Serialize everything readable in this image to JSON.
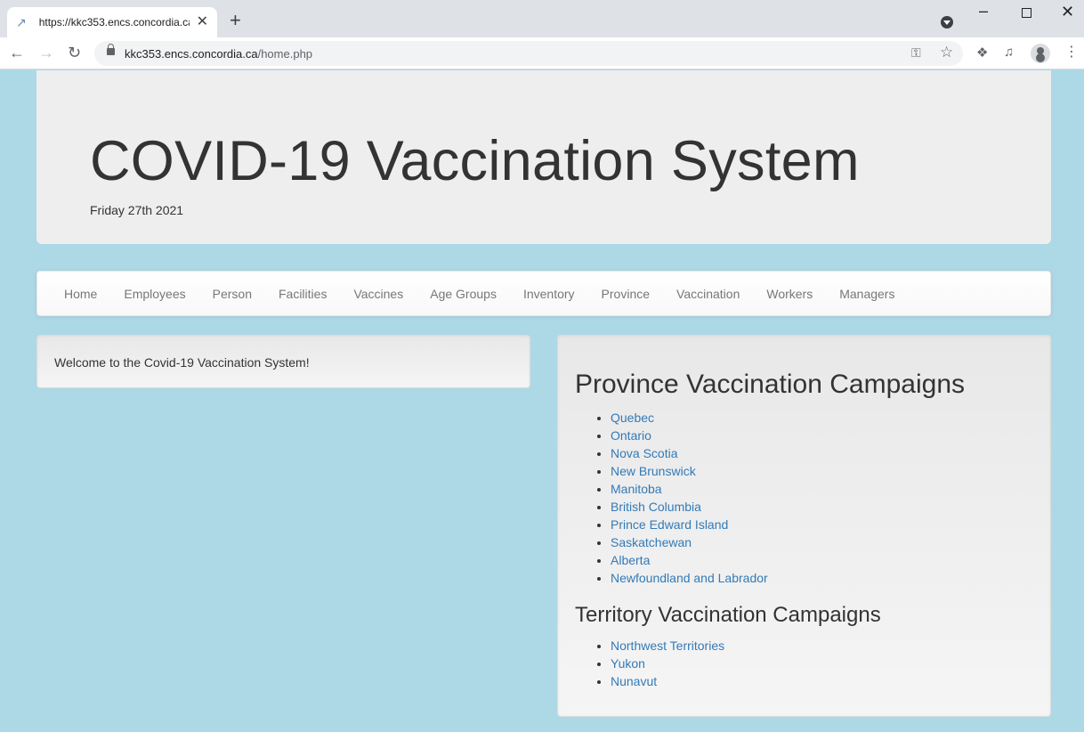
{
  "browser": {
    "tab_title": "https://kkc353.encs.concordia.ca",
    "url_host": "kkc353.encs.concordia.ca",
    "url_path": "/home.php"
  },
  "header": {
    "title": "COVID-19 Vaccination System",
    "date": "Friday 27th 2021"
  },
  "nav": {
    "items": [
      "Home",
      "Employees",
      "Person",
      "Facilities",
      "Vaccines",
      "Age Groups",
      "Inventory",
      "Province",
      "Vaccination",
      "Workers",
      "Managers"
    ]
  },
  "welcome": {
    "text": "Welcome to the Covid-19 Vaccination System!"
  },
  "campaigns": {
    "province_heading": "Province Vaccination Campaigns",
    "provinces": [
      "Quebec",
      "Ontario",
      "Nova Scotia",
      "New Brunswick",
      "Manitoba",
      "British Columbia",
      "Prince Edward Island",
      "Saskatchewan",
      "Alberta",
      "Newfoundland and Labrador"
    ],
    "territory_heading": "Territory Vaccination Campaigns",
    "territories": [
      "Northwest Territories",
      "Yukon",
      "Nunavut"
    ]
  },
  "colors": {
    "page_background": "#add8e6",
    "link": "#337ab7",
    "jumbotron": "#eeeeee"
  }
}
